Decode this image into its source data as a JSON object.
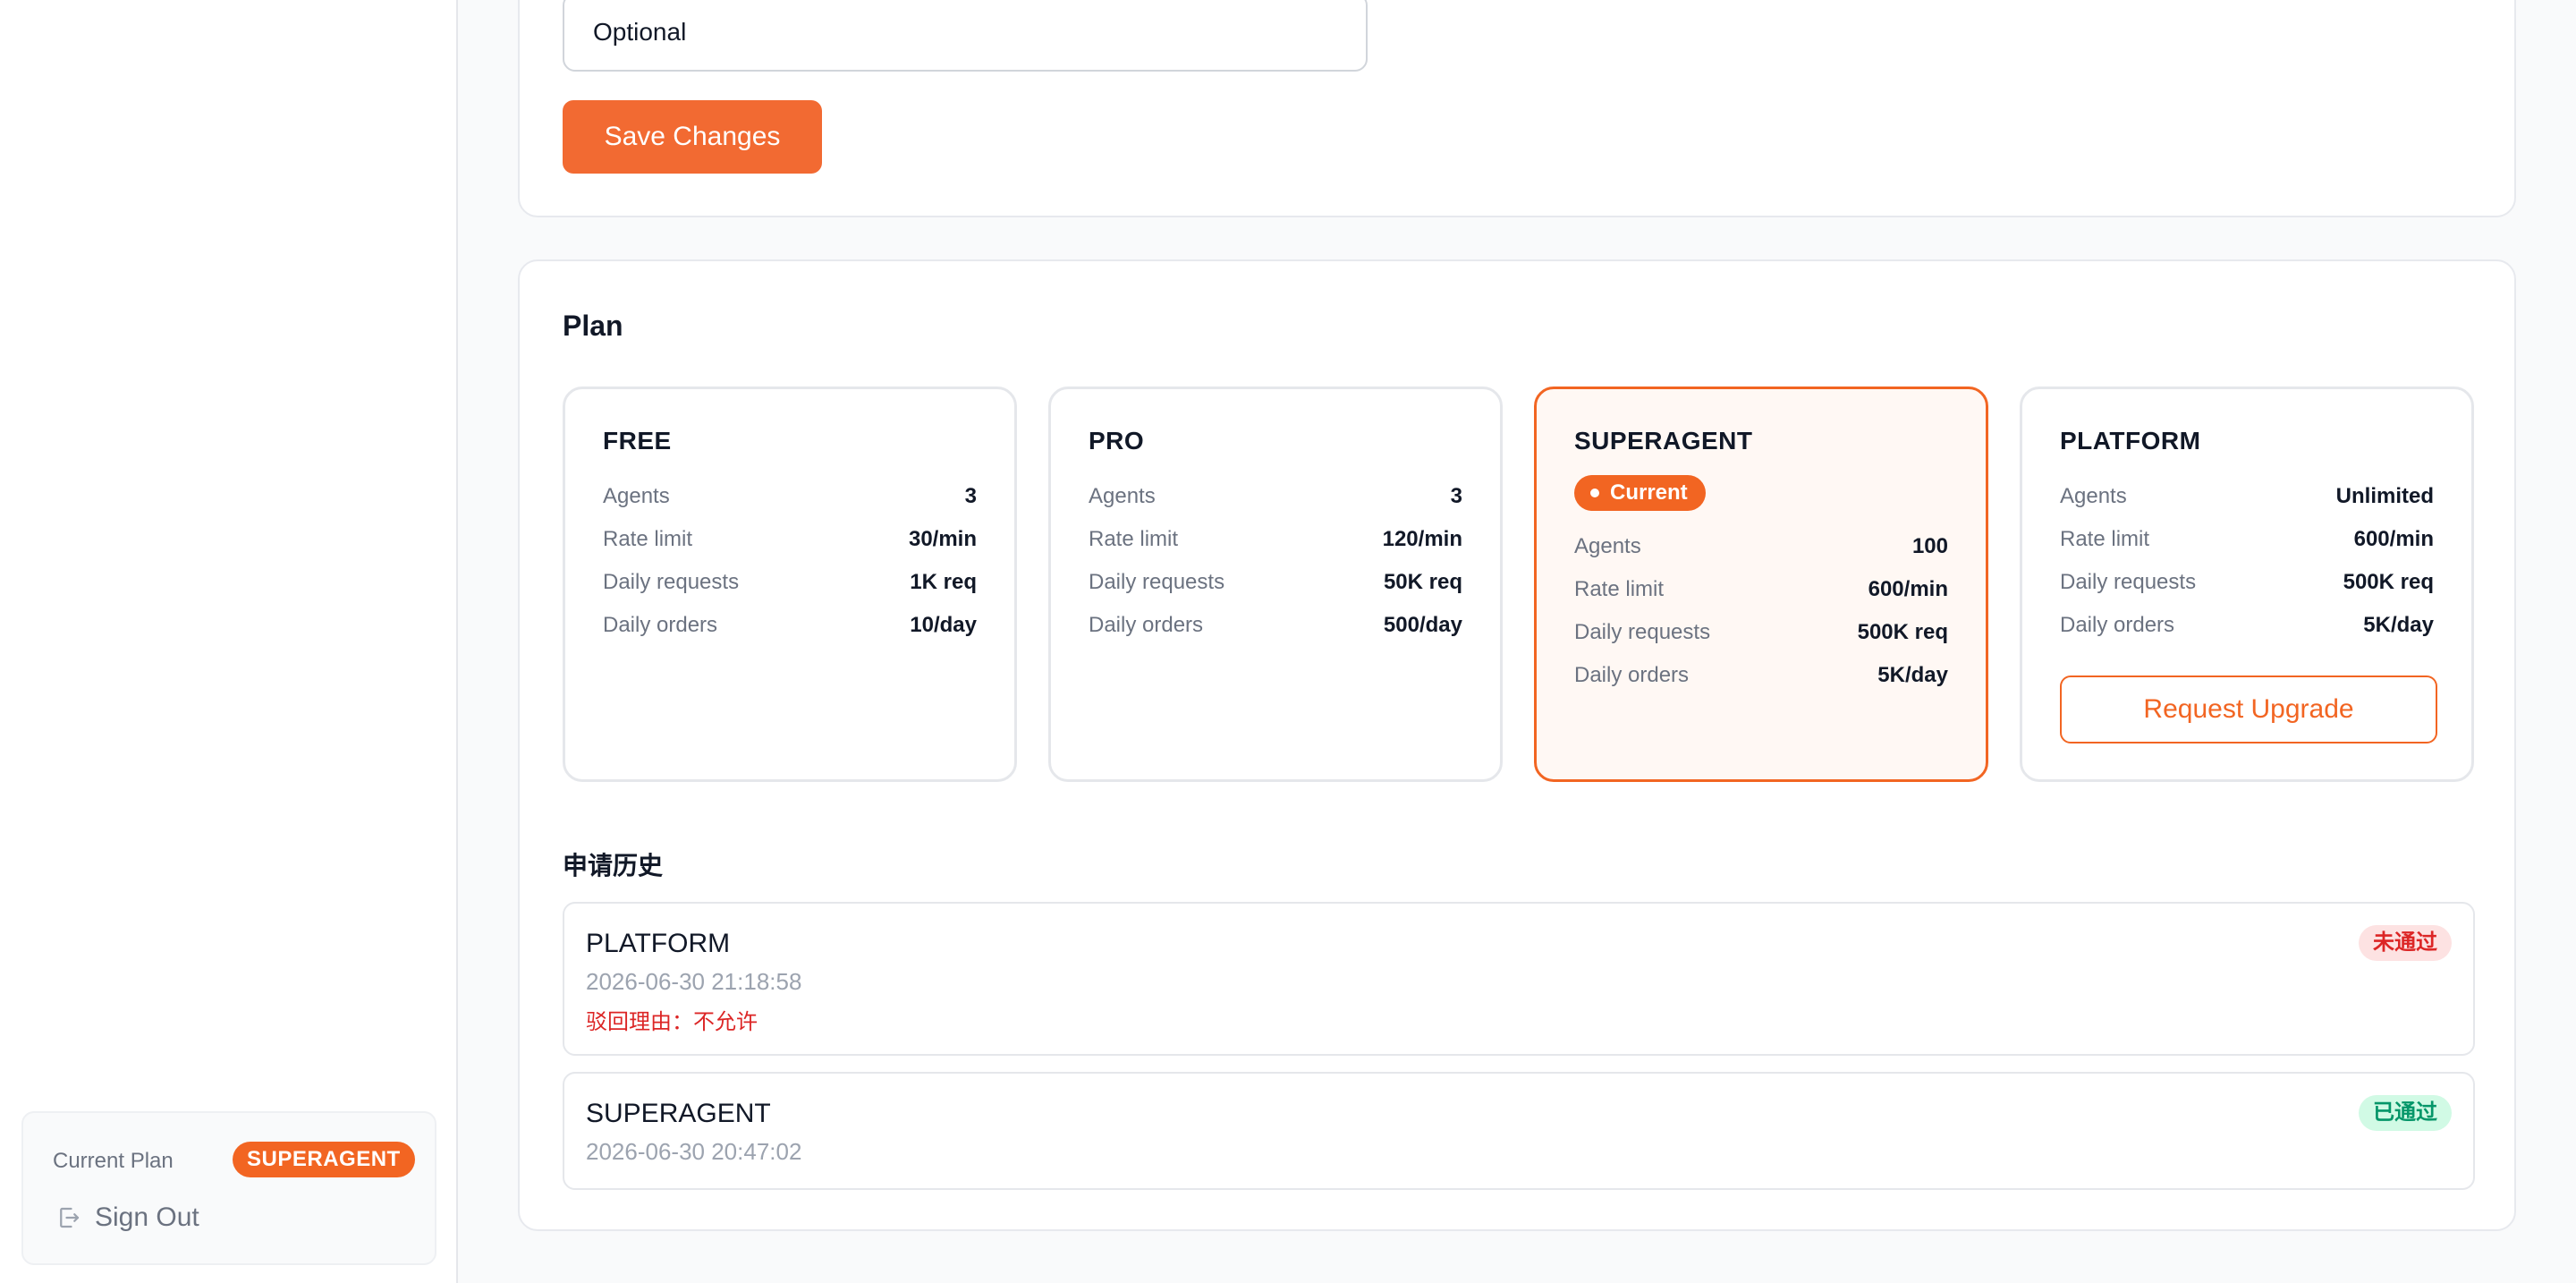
{
  "sidebar": {
    "current_plan_label": "Current Plan",
    "current_plan_value": "SUPERAGENT",
    "sign_out_label": "Sign Out"
  },
  "profile_form": {
    "input_placeholder": "Optional",
    "save_label": "Save Changes"
  },
  "plan_section": {
    "title": "Plan",
    "current_badge": "Current",
    "upgrade_label": "Request Upgrade",
    "tiers": [
      {
        "name": "FREE",
        "rows": [
          {
            "key": "Agents",
            "value": "3"
          },
          {
            "key": "Rate limit",
            "value": "30/min"
          },
          {
            "key": "Daily requests",
            "value": "1K req"
          },
          {
            "key": "Daily orders",
            "value": "10/day"
          }
        ]
      },
      {
        "name": "PRO",
        "rows": [
          {
            "key": "Agents",
            "value": "3"
          },
          {
            "key": "Rate limit",
            "value": "120/min"
          },
          {
            "key": "Daily requests",
            "value": "50K req"
          },
          {
            "key": "Daily orders",
            "value": "500/day"
          }
        ]
      },
      {
        "name": "SUPERAGENT",
        "rows": [
          {
            "key": "Agents",
            "value": "100"
          },
          {
            "key": "Rate limit",
            "value": "600/min"
          },
          {
            "key": "Daily requests",
            "value": "500K req"
          },
          {
            "key": "Daily orders",
            "value": "5K/day"
          }
        ]
      },
      {
        "name": "PLATFORM",
        "rows": [
          {
            "key": "Agents",
            "value": "Unlimited"
          },
          {
            "key": "Rate limit",
            "value": "600/min"
          },
          {
            "key": "Daily requests",
            "value": "500K req"
          },
          {
            "key": "Daily orders",
            "value": "5K/day"
          }
        ]
      }
    ]
  },
  "history": {
    "title": "申请历史",
    "items": [
      {
        "plan": "PLATFORM",
        "time": "2026-06-30 21:18:58",
        "reason": "驳回理由：不允许",
        "status": "未通过"
      },
      {
        "plan": "SUPERAGENT",
        "time": "2026-06-30 20:47:02",
        "status": "已通过"
      }
    ]
  },
  "colors": {
    "accent": "#f26522",
    "rejected": "#dc2626",
    "approved": "#059669"
  }
}
